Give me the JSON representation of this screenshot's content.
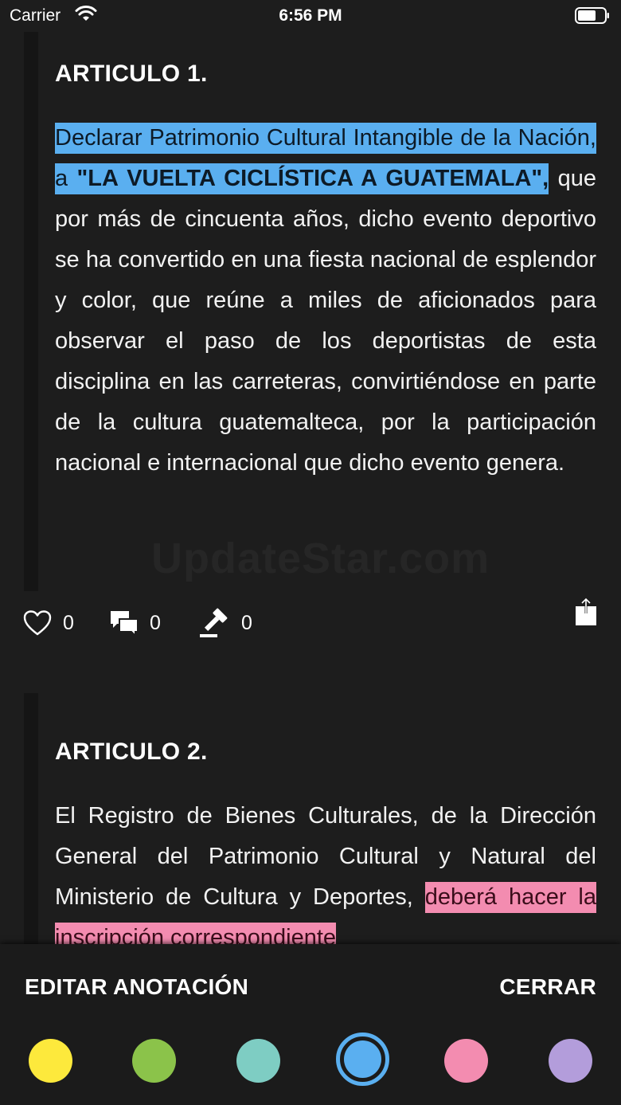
{
  "status_bar": {
    "carrier": "Carrier",
    "time": "6:56 PM"
  },
  "articles": [
    {
      "title": "ARTICULO 1.",
      "body_highlight_plain": "Declarar Patrimonio Cultural Intangible de la Nación, a",
      "body_highlight_bold": "\"LA VUELTA CICLÍSTICA A GUATEMALA\",",
      "body_rest": " que por más de cincuenta años, dicho evento deportivo se ha convertido en una fiesta nacional de esplendor y color, que reúne a miles de aficionados para observar el paso de los deportistas de esta disciplina en las carreteras, convirtiéndose en parte de la cultura guatemalteca, por la participación nacional e internacional que dicho evento genera.",
      "likes": "0",
      "comments": "0",
      "votes": "0"
    },
    {
      "title": "ARTICULO 2.",
      "body_plain": "El Registro de Bienes Culturales, de la Dirección General del Patrimonio Cultural y Natural del Ministerio de Cultura y Deportes, ",
      "body_highlight": "deberá hacer la inscripción correspondiente"
    }
  ],
  "watermark": "UpdateStar.com",
  "panel": {
    "edit_label": "EDITAR ANOTACIÓN",
    "close_label": "CERRAR",
    "selected_color": "blue",
    "colors": [
      {
        "name": "yellow",
        "hex": "#fde93c"
      },
      {
        "name": "green",
        "hex": "#8bc34a"
      },
      {
        "name": "teal",
        "hex": "#7ecdc3"
      },
      {
        "name": "blue",
        "hex": "#5aaff0"
      },
      {
        "name": "pink",
        "hex": "#f38cb0"
      },
      {
        "name": "purple",
        "hex": "#b39ddb"
      }
    ]
  }
}
